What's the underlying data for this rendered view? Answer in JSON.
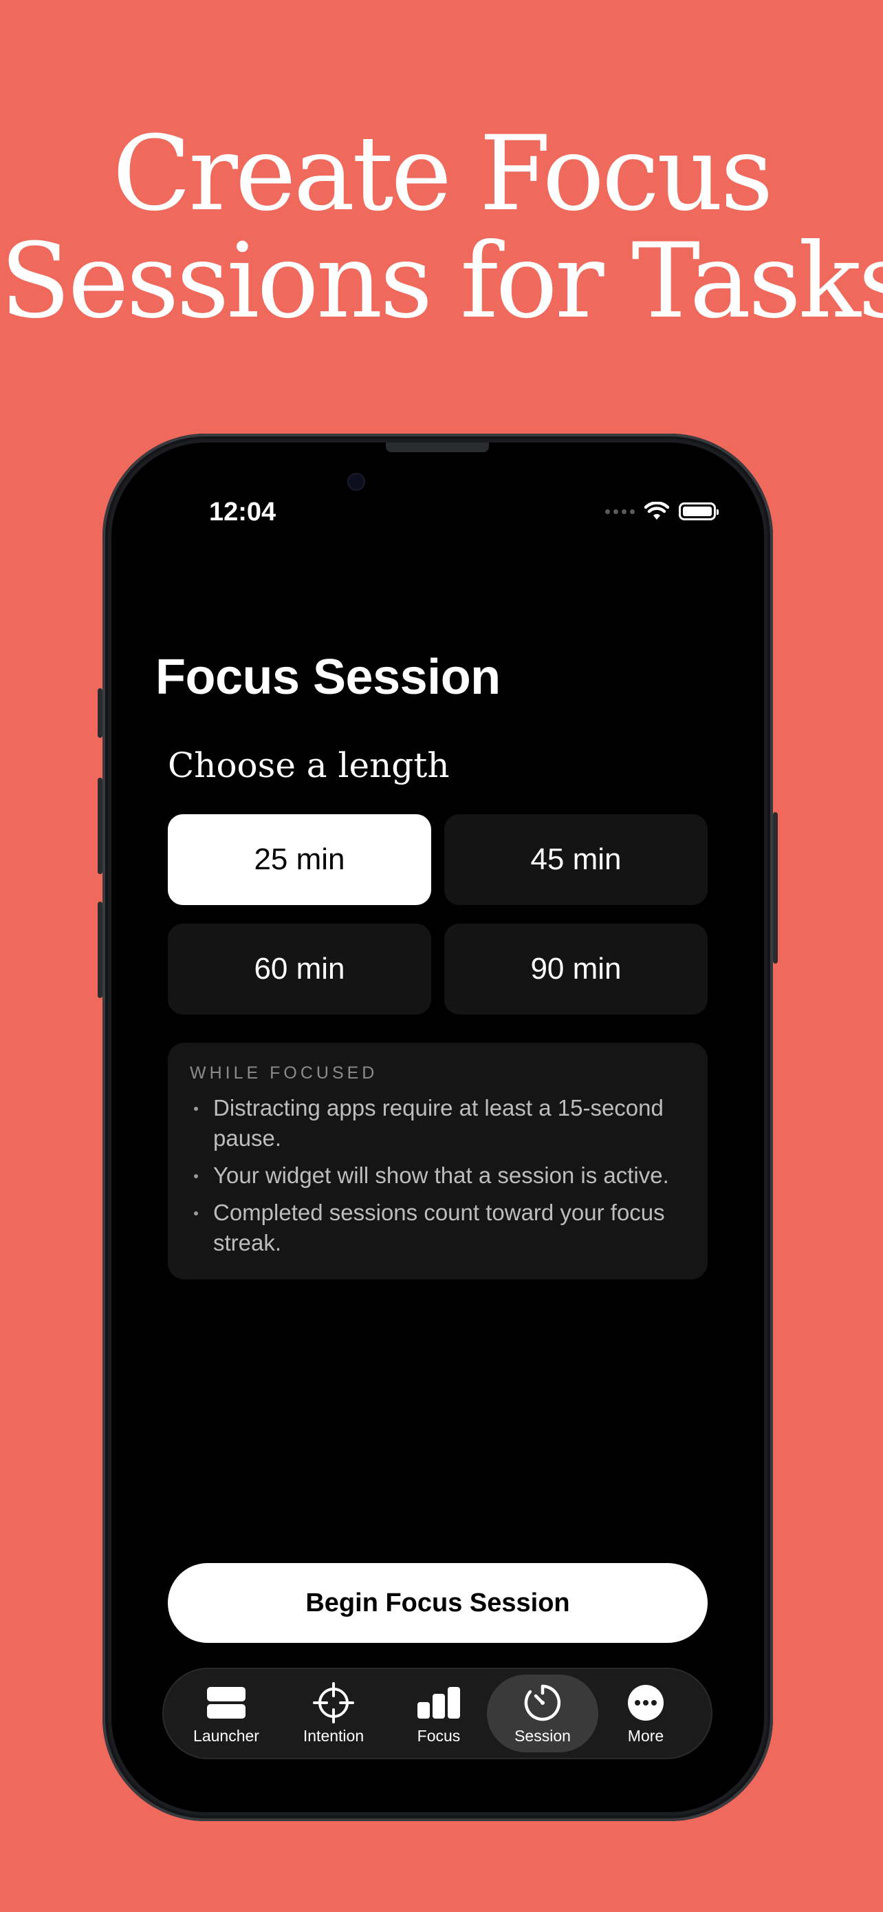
{
  "headline": {
    "line1": "Create Focus",
    "line2": "Sessions for Tasks"
  },
  "status_bar": {
    "time": "12:04"
  },
  "screen": {
    "title": "Focus Session",
    "subtitle": "Choose a length",
    "lengths": [
      {
        "label": "25 min",
        "selected": true
      },
      {
        "label": "45 min",
        "selected": false
      },
      {
        "label": "60 min",
        "selected": false
      },
      {
        "label": "90 min",
        "selected": false
      }
    ],
    "info": {
      "heading": "WHILE FOCUSED",
      "items": [
        "Distracting apps require at least a 15-second pause.",
        "Your widget will show that a session is active.",
        "Completed sessions count toward your focus streak."
      ]
    },
    "begin_label": "Begin Focus Session"
  },
  "tabs": [
    {
      "label": "Launcher",
      "icon": "launcher-icon"
    },
    {
      "label": "Intention",
      "icon": "crosshair-icon"
    },
    {
      "label": "Focus",
      "icon": "bar-chart-icon"
    },
    {
      "label": "Session",
      "icon": "timer-icon",
      "active": true
    },
    {
      "label": "More",
      "icon": "more-icon"
    }
  ],
  "colors": {
    "background": "#EF6A5C",
    "screen": "#000000",
    "card": "#151515"
  }
}
